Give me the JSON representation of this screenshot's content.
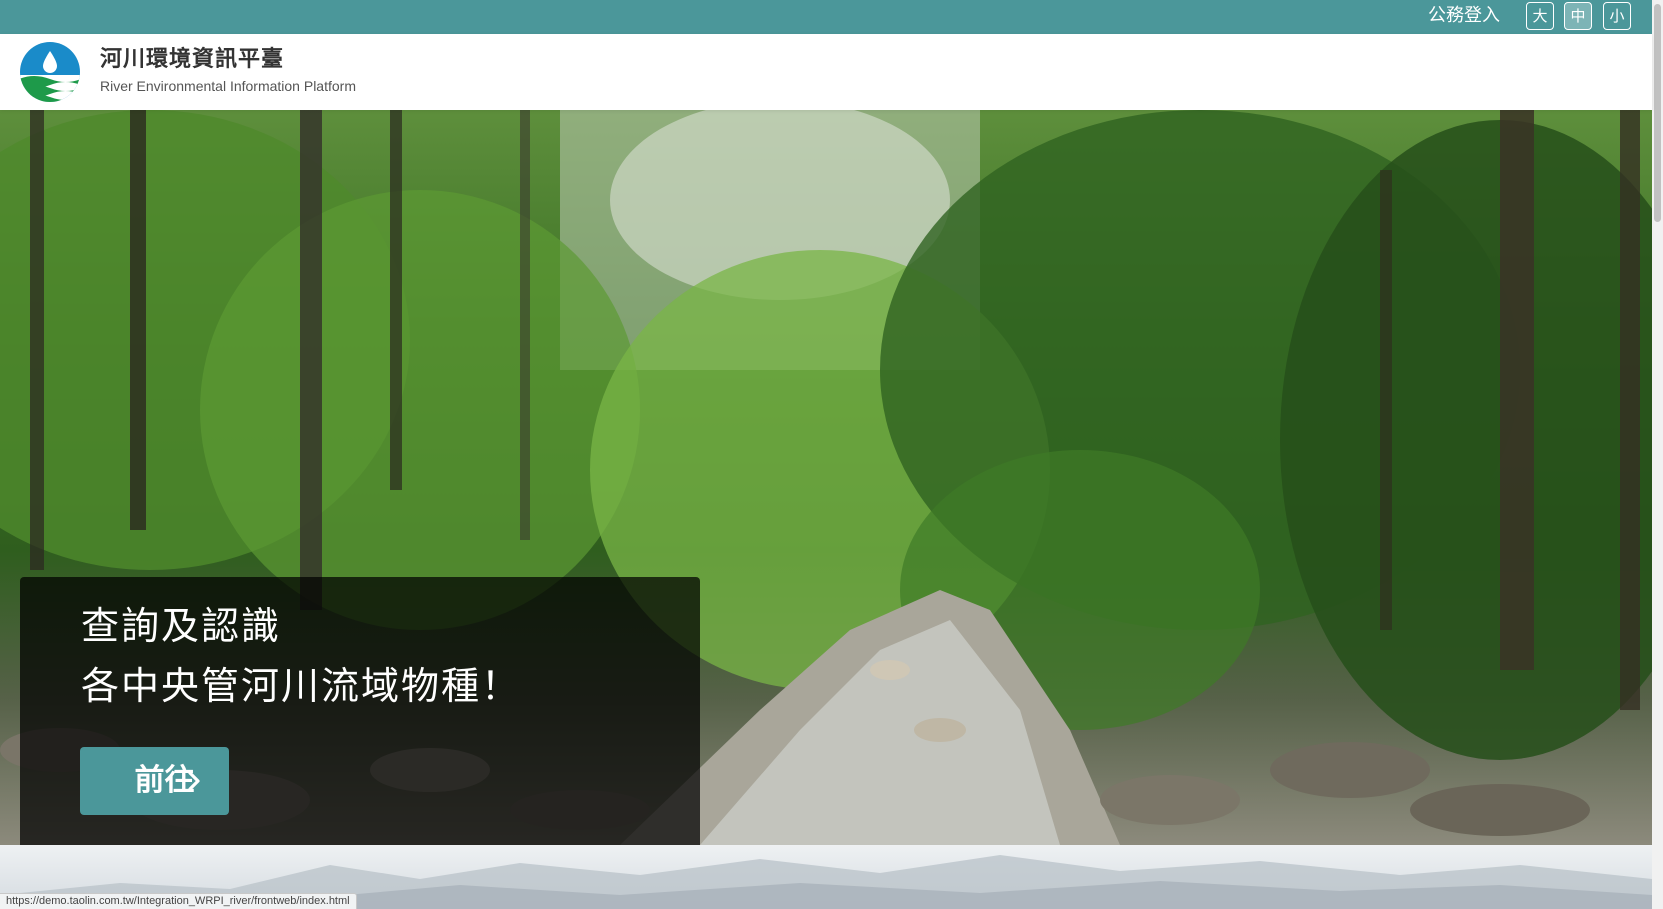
{
  "topbar": {
    "login_label": "公務登入",
    "font_sizes": [
      "大",
      "中",
      "小"
    ],
    "active_font_size": "中",
    "background": "#4b979a"
  },
  "header": {
    "title": "河川環境資訊平臺",
    "subtitle": "River Environmental Information Platform",
    "logo_icon": "water-drop-logo-icon"
  },
  "hero": {
    "line1": "查詢及認識",
    "line2": "各中央管河川流域物種！",
    "button_label": "前往",
    "button_icon": "chevron-right-icon",
    "accent": "#4b979a"
  },
  "status_bar": {
    "url": "https://demo.taolin.com.tw/Integration_WRPI_river/frontweb/index.html"
  }
}
